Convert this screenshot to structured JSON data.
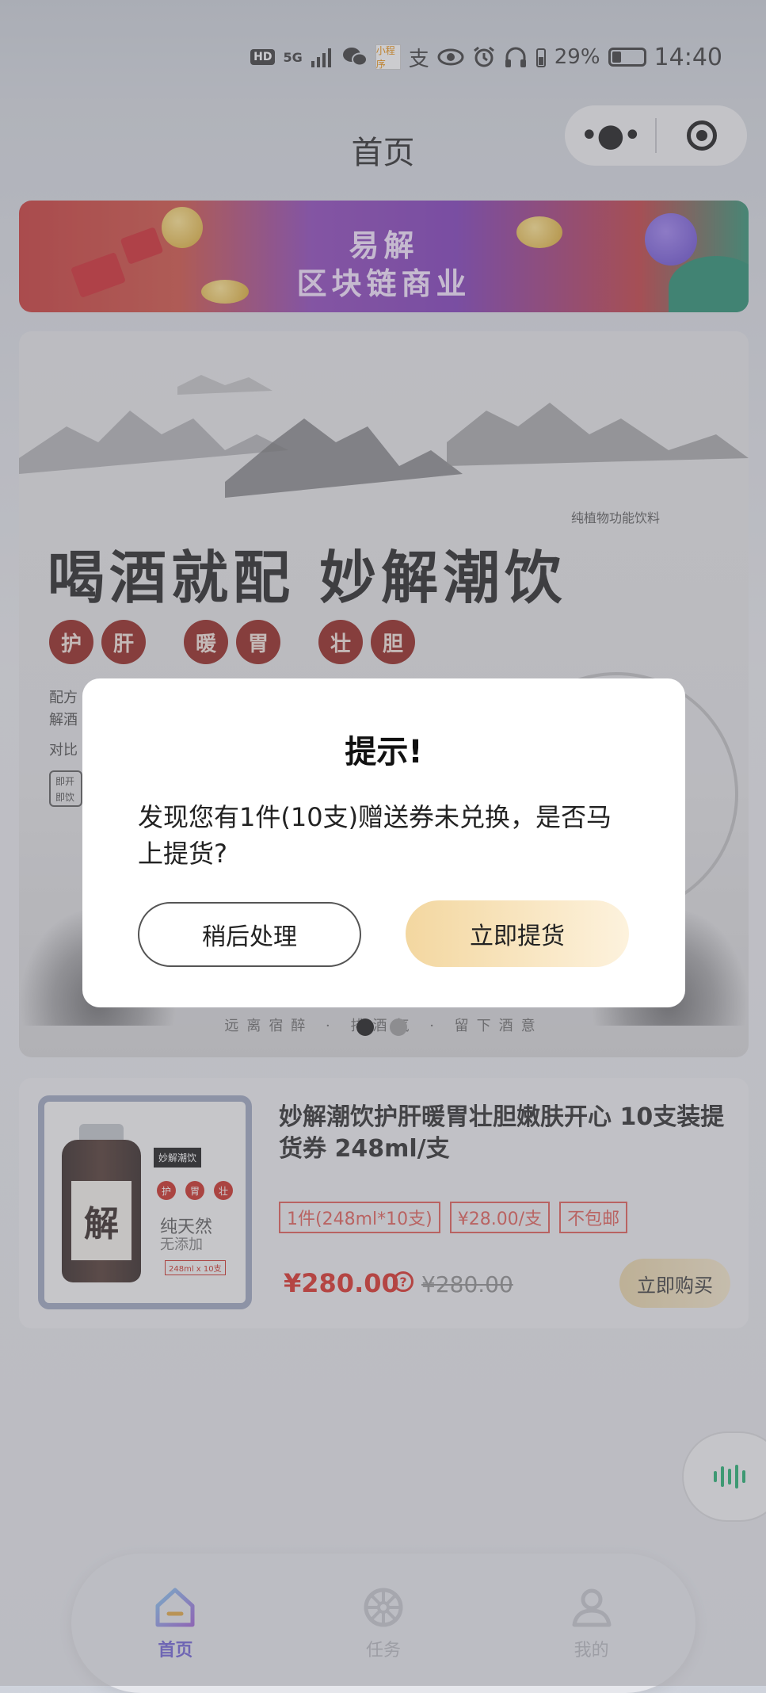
{
  "status_bar": {
    "network_badge": "HD",
    "network_type": "5G",
    "app_icon_text": "小程序",
    "alipay_icon": "支",
    "battery_percent": "29%",
    "battery_level": 0.29,
    "time": "14:40"
  },
  "nav": {
    "title": "首页",
    "capsule_more": "•●•"
  },
  "banner": {
    "line1": "易解",
    "line2": "区块链商业"
  },
  "poster": {
    "tagline": "纯植物功能饮料",
    "slogan": "喝酒就配 妙解潮饮",
    "seals": [
      "护",
      "肝",
      "暖",
      "胃",
      "壮",
      "胆"
    ],
    "text_line1": "配方",
    "text_line2": "解酒",
    "text_line3": "对比",
    "box_text": "即开 即饮",
    "footer": "远离宿醉 · 排酒气 · 留下酒意"
  },
  "carousel": {
    "total": 2,
    "active_index": 0
  },
  "product": {
    "title": "妙解潮饮护肝暖胃壮胆嫩肤开心 10支装提货券 248ml/支",
    "image": {
      "tag": "妙解潮饮",
      "seal1": "护",
      "seal2": "胃",
      "seal3": "壮",
      "label_char": "解",
      "text1": "纯天然",
      "text2": "无添加",
      "chip": "248ml x 10支"
    },
    "tags": [
      "1件(248ml*10支)",
      "¥28.00/支",
      "不包邮"
    ],
    "price": "¥280.00",
    "old_price": "¥280.00",
    "buy_label": "立即购买"
  },
  "dialog": {
    "title": "提示!",
    "message": "发现您有1件(10支)赠送券未兑换，是否马上提货?",
    "later_label": "稍后处理",
    "now_label": "立即提货"
  },
  "tabbar": {
    "items": [
      {
        "label": "首页",
        "icon": "home-icon",
        "active": true
      },
      {
        "label": "任务",
        "icon": "task-icon",
        "active": false
      },
      {
        "label": "我的",
        "icon": "profile-icon",
        "active": false
      }
    ]
  },
  "colors": {
    "accent_purple": "#6a5bd3",
    "price_red": "#d8261d",
    "tag_red": "#e0564f",
    "primary_button_gold": "#f3d7a0",
    "voice_green": "#1aad6b"
  }
}
